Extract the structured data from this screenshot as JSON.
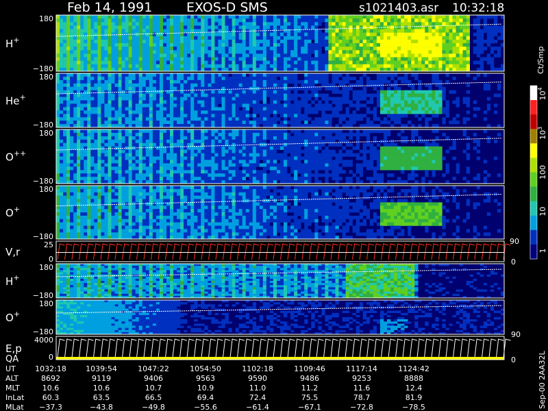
{
  "header": {
    "date": "Feb 14, 1991",
    "instrument": "EXOS-D SMS",
    "file": "s1021403.asr",
    "time": "10:32:18"
  },
  "colorbar": {
    "unit": "Ct/Smp",
    "ticks": [
      {
        "label": "1",
        "sup": ""
      },
      {
        "label": "10",
        "sup": ""
      },
      {
        "label": "100",
        "sup": ""
      },
      {
        "label": "10",
        "sup": "3"
      },
      {
        "label": "10",
        "sup": "4"
      }
    ],
    "colors": [
      "#000080",
      "#0030c0",
      "#00a0e0",
      "#20c8b0",
      "#30b040",
      "#60d020",
      "#b0e000",
      "#ffff00",
      "#a08000",
      "#c00000",
      "#ff2020",
      "#ffffff"
    ]
  },
  "footer": {
    "stamp": "Sep-00 2AA32L"
  },
  "chart_data": {
    "type": "heatmap",
    "panels": [
      {
        "label": "H",
        "sup": "+",
        "ytop": "180",
        "ybot": "−180",
        "right_top": "",
        "right_bot": "",
        "kind": "spec",
        "intensity": 3.0
      },
      {
        "label": "He",
        "sup": "+",
        "ytop": "180",
        "ybot": "−180",
        "right_top": "",
        "right_bot": "",
        "kind": "spec",
        "intensity": 1.4
      },
      {
        "label": "O",
        "sup": "++",
        "ytop": "180",
        "ybot": "−180",
        "right_top": "",
        "right_bot": "",
        "kind": "spec",
        "intensity": 1.6
      },
      {
        "label": "O",
        "sup": "+",
        "ytop": "180",
        "ybot": "−180",
        "right_top": "",
        "right_bot": "",
        "kind": "spec",
        "intensity": 1.9
      },
      {
        "label": "V,r",
        "sup": "",
        "ytop": "25",
        "ybot": "0",
        "right_top": "90",
        "right_bot": "0",
        "kind": "sawtooth_red",
        "intensity": 0
      },
      {
        "label": "H",
        "sup": "+",
        "ytop": "180",
        "ybot": "−180",
        "right_top": "",
        "right_bot": "",
        "kind": "spec2",
        "intensity": 1.8
      },
      {
        "label": "O",
        "sup": "+",
        "ytop": "180",
        "ybot": "−180",
        "right_top": "",
        "right_bot": "90",
        "kind": "spec3",
        "intensity": 1.0
      },
      {
        "label": "E,p",
        "sup": "",
        "label2": "QA",
        "ytop": "4000",
        "ybot": "0",
        "right_top": "",
        "right_bot": "0",
        "kind": "sawtooth_white",
        "intensity": 0
      }
    ],
    "x_axis": {
      "rows": [
        {
          "name": "UT",
          "values": [
            "1032:18",
            "1039:54",
            "1047:22",
            "1054:50",
            "1102:18",
            "1109:46",
            "1117:14",
            "1124:42"
          ]
        },
        {
          "name": "ALT",
          "values": [
            "8692",
            "9119",
            "9406",
            "9563",
            "9590",
            "9486",
            "9253",
            "8888"
          ]
        },
        {
          "name": "MLT",
          "values": [
            "10.6",
            "10.6",
            "10.7",
            "10.9",
            "11.0",
            "11.2",
            "11.6",
            "12.4"
          ]
        },
        {
          "name": "InLat",
          "values": [
            "60.3",
            "63.5",
            "66.5",
            "69.4",
            "72.4",
            "75.5",
            "78.7",
            "81.9"
          ]
        },
        {
          "name": "MLat",
          "values": [
            "−37.3",
            "−43.8",
            "−49.8",
            "−55.6",
            "−61.4",
            "−67.1",
            "−72.8",
            "−78.5"
          ]
        }
      ]
    }
  }
}
